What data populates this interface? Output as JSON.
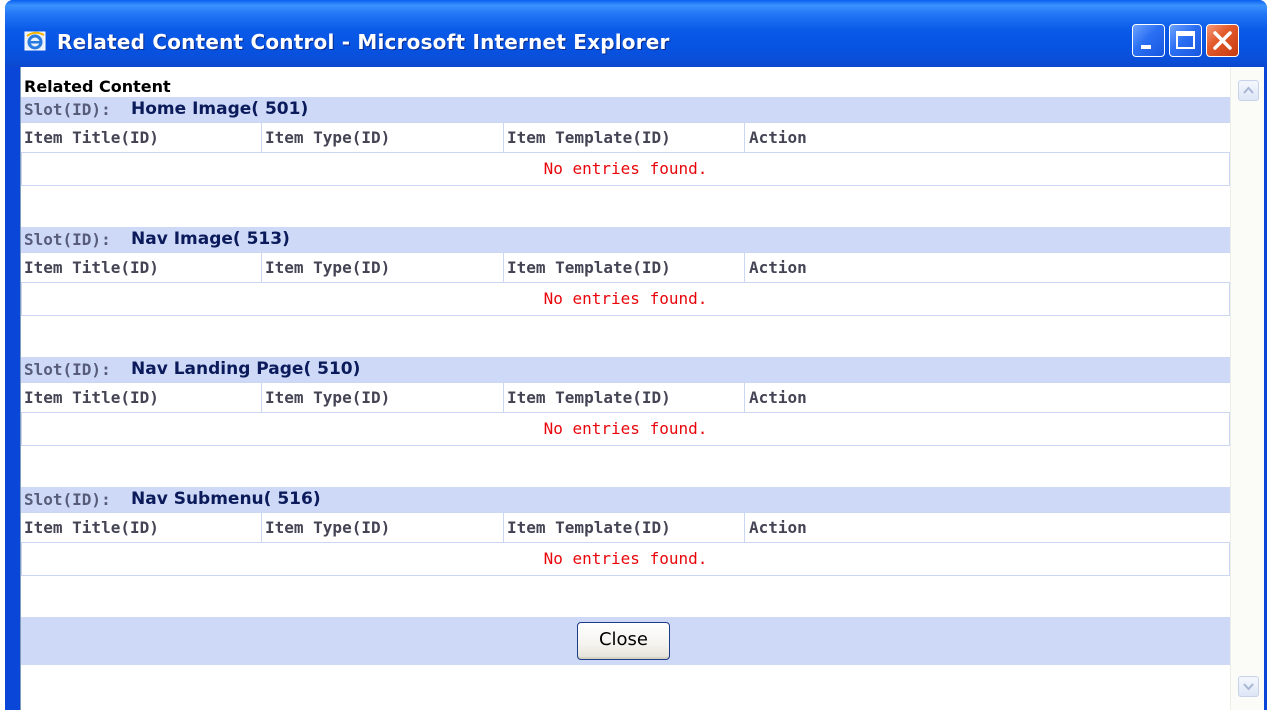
{
  "window": {
    "title": "Related Content Control - Microsoft Internet Explorer",
    "app_icon": "ie-icon",
    "controls": {
      "minimize": "minimize-icon",
      "maximize": "maximize-icon",
      "close": "close-icon"
    }
  },
  "page": {
    "heading": "Related Content",
    "slot_label": "Slot(ID):",
    "columns": [
      "Item Title(ID)",
      "Item Type(ID)",
      "Item Template(ID)",
      "Action"
    ],
    "empty_message": "No entries found.",
    "slots": [
      {
        "name": "Home Image( 501)"
      },
      {
        "name": "Nav Image( 513)"
      },
      {
        "name": "Nav Landing Page( 510)"
      },
      {
        "name": "Nav Submenu( 516)"
      }
    ],
    "close_label": "Close"
  },
  "colors": {
    "title_bar": "#0a5ae8",
    "section_header_bg": "#cdd9f7",
    "slot_name_text": "#0b1a5a",
    "empty_message_text": "#e8060b",
    "close_button_border": "#1c3c86"
  }
}
